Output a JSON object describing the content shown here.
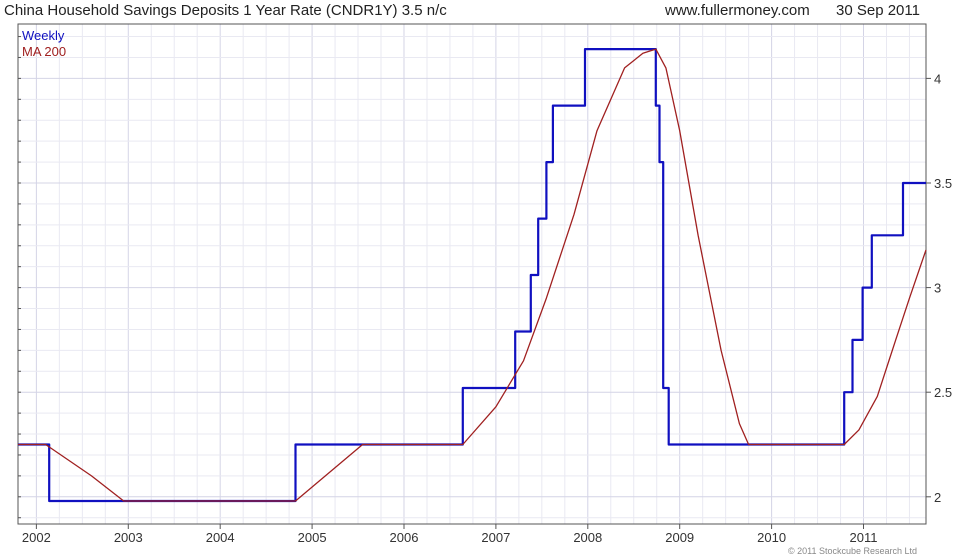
{
  "header": {
    "title": "China Household Savings Deposits 1 Year Rate (CNDR1Y) 3.5 n/c",
    "site": "www.fullermoney.com",
    "date": "30 Sep 2011"
  },
  "footer": {
    "credit": "© 2011 Stockcube Research Ltd"
  },
  "chart_data": {
    "type": "line",
    "xlim": [
      2001.8,
      2011.68
    ],
    "ylim": [
      1.87,
      4.26
    ],
    "grid": true,
    "legend_position": "top-left",
    "x_ticks": [
      2002,
      2003,
      2004,
      2005,
      2006,
      2007,
      2008,
      2009,
      2010,
      2011
    ],
    "x_tick_labels": [
      "2002",
      "2003",
      "2004",
      "2005",
      "2006",
      "2007",
      "2008",
      "2009",
      "2010",
      "2011"
    ],
    "y_ticks": [
      2,
      2.5,
      3,
      3.5,
      4
    ],
    "y_tick_labels": [
      "2",
      "2.5",
      "3",
      "3.5",
      "4"
    ],
    "series": [
      {
        "name": "Weekly",
        "color": "#1010c0",
        "step": true,
        "x": [
          2001.8,
          2002.14,
          2004.82,
          2006.64,
          2007.21,
          2007.38,
          2007.46,
          2007.55,
          2007.62,
          2007.97,
          2008.74,
          2008.78,
          2008.82,
          2008.88,
          2008.97,
          2010.79,
          2010.88,
          2010.99,
          2011.09,
          2011.43,
          2011.68
        ],
        "y": [
          2.25,
          1.98,
          2.25,
          2.52,
          2.79,
          3.06,
          3.33,
          3.6,
          3.87,
          4.14,
          3.87,
          3.6,
          2.52,
          2.25,
          2.25,
          2.5,
          2.75,
          3.0,
          3.25,
          3.5,
          3.5
        ],
        "values_note": ""
      },
      {
        "name": "MA 200",
        "color": "#a02020",
        "step": false,
        "x": [
          2001.8,
          2002.1,
          2002.6,
          2002.95,
          2004.82,
          2005.55,
          2006.64,
          2007.0,
          2007.3,
          2007.55,
          2007.85,
          2008.1,
          2008.4,
          2008.6,
          2008.74,
          2008.85,
          2009.0,
          2009.2,
          2009.45,
          2009.65,
          2009.75,
          2010.79,
          2010.95,
          2011.15,
          2011.35,
          2011.5,
          2011.68
        ],
        "y": [
          2.25,
          2.25,
          2.1,
          1.98,
          1.98,
          2.25,
          2.25,
          2.43,
          2.65,
          2.95,
          3.35,
          3.75,
          4.05,
          4.12,
          4.14,
          4.05,
          3.75,
          3.25,
          2.7,
          2.35,
          2.25,
          2.25,
          2.32,
          2.48,
          2.75,
          2.95,
          3.18
        ]
      }
    ]
  }
}
